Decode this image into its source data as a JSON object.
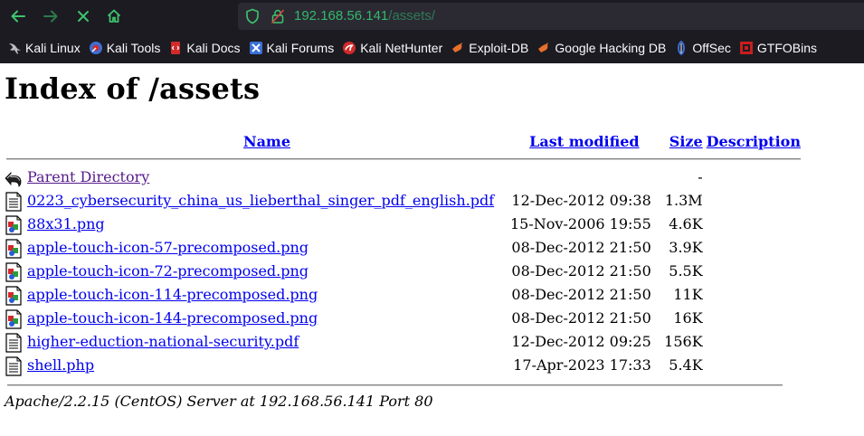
{
  "browser": {
    "url_host": "192.168.56.141",
    "url_path": "/assets/",
    "bookmarks": [
      {
        "label": "Kali Linux",
        "icon": "kali-dragon-icon",
        "color": "#c8c8c8"
      },
      {
        "label": "Kali Tools",
        "icon": "kali-tools-icon",
        "color": "#3b6fd6"
      },
      {
        "label": "Kali Docs",
        "icon": "kali-docs-icon",
        "color": "#d12a2a"
      },
      {
        "label": "Kali Forums",
        "icon": "kali-forums-icon",
        "color": "#3b6fd6"
      },
      {
        "label": "Kali NetHunter",
        "icon": "nethunter-icon",
        "color": "#d12a2a"
      },
      {
        "label": "Exploit-DB",
        "icon": "exploit-db-icon",
        "color": "#e8702a"
      },
      {
        "label": "Google Hacking DB",
        "icon": "ghdb-icon",
        "color": "#e8702a"
      },
      {
        "label": "OffSec",
        "icon": "offsec-icon",
        "color": "#3b6fd6"
      },
      {
        "label": "GTFOBins",
        "icon": "gtfobins-icon",
        "color": "#c81e1e"
      }
    ]
  },
  "page": {
    "title": "Index of /assets",
    "columns": {
      "name": "Name",
      "modified": "Last modified",
      "size": "Size",
      "description": "Description"
    },
    "parent": {
      "label": "Parent Directory",
      "size": "-"
    },
    "rows": [
      {
        "name": "0223_cybersecurity_china_us_lieberthal_singer_pdf_english.pdf",
        "modified": "12-Dec-2012 09:38",
        "size": "1.3M",
        "type": "text"
      },
      {
        "name": "88x31.png",
        "modified": "15-Nov-2006 19:55",
        "size": "4.6K",
        "type": "image"
      },
      {
        "name": "apple-touch-icon-57-precomposed.png",
        "modified": "08-Dec-2012 21:50",
        "size": "3.9K",
        "type": "image"
      },
      {
        "name": "apple-touch-icon-72-precomposed.png",
        "modified": "08-Dec-2012 21:50",
        "size": "5.5K",
        "type": "image"
      },
      {
        "name": "apple-touch-icon-114-precomposed.png",
        "modified": "08-Dec-2012 21:50",
        "size": "11K",
        "type": "image"
      },
      {
        "name": "apple-touch-icon-144-precomposed.png",
        "modified": "08-Dec-2012 21:50",
        "size": "16K",
        "type": "image"
      },
      {
        "name": "higher-eduction-national-security.pdf",
        "modified": "12-Dec-2012 09:25",
        "size": "156K",
        "type": "text"
      },
      {
        "name": "shell.php",
        "modified": "17-Apr-2023 17:33",
        "size": "5.4K",
        "type": "text"
      }
    ],
    "footer": "Apache/2.2.15 (CentOS) Server at 192.168.56.141 Port 80"
  },
  "colors": {
    "chrome_bg": "#1c1b22",
    "url_text": "#33b86b",
    "link": "#0000ee",
    "visited": "#551a8b"
  }
}
